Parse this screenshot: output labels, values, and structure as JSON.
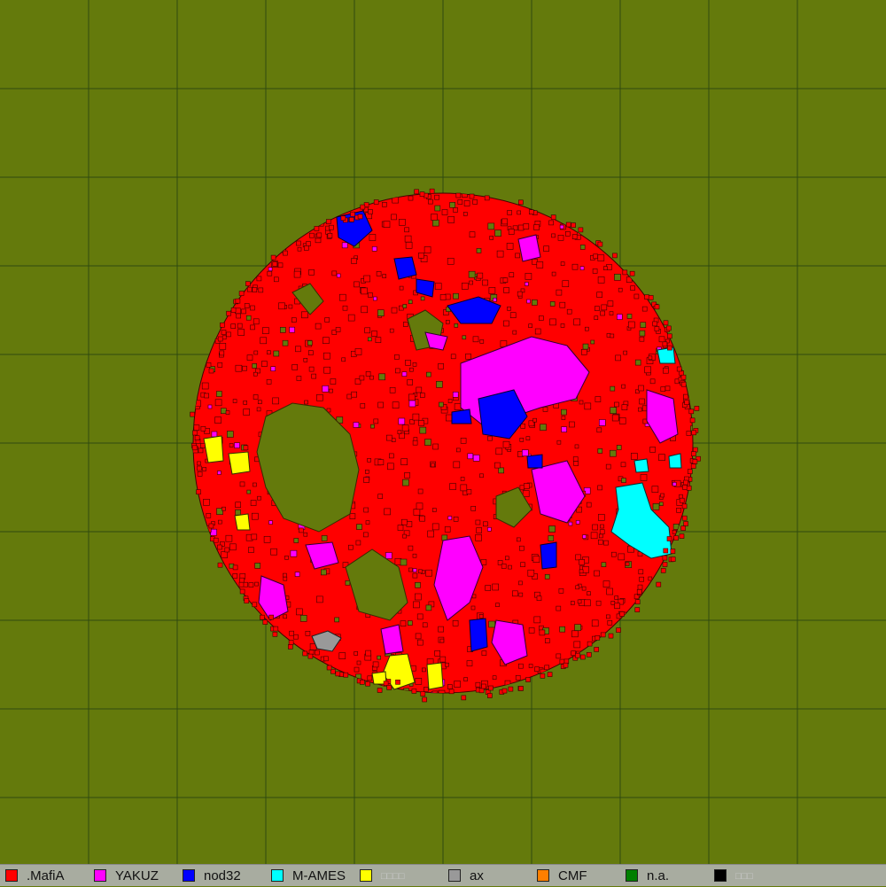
{
  "map": {
    "background_color": "#647a0c",
    "grid_color": "#2f4a10",
    "grid_columns": 10,
    "grid_rows": 10
  },
  "legend": {
    "items": [
      {
        "name": ".MafiA",
        "color": "#ff0000"
      },
      {
        "name": "YAKUZ",
        "color": "#ff00ff"
      },
      {
        "name": "nod32",
        "color": "#0000ff"
      },
      {
        "name": "M-AMES",
        "color": "#00ffff"
      },
      {
        "name": "□□□□",
        "color": "#ffff00"
      },
      {
        "name": "ax",
        "color": "#999999"
      },
      {
        "name": "CMF",
        "color": "#ff7f00"
      },
      {
        "name": "n.a.",
        "color": "#007f00"
      },
      {
        "name": "□□□",
        "color": "#000000"
      }
    ]
  }
}
